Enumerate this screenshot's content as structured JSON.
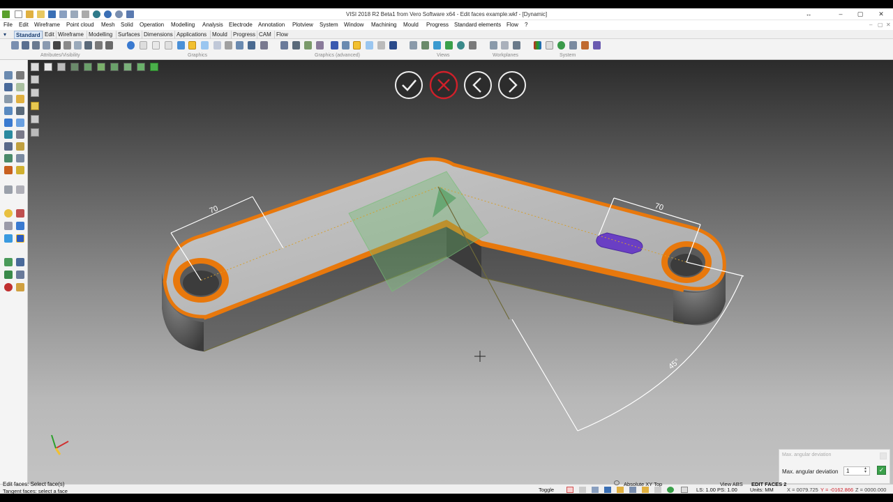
{
  "window": {
    "title": "VISI 2018 R2 Beta1 from Vero Software x64 - Edit faces example.wkf - [Dynamic]"
  },
  "menu": [
    "File",
    "Edit",
    "Wireframe",
    "Point cloud",
    "Mesh",
    "Solid",
    "Operation",
    "Modelling",
    "Analysis",
    "Electrode",
    "Annotation",
    "Plotview",
    "System",
    "Window",
    "Machining",
    "Mould",
    "Progress",
    "Standard elements",
    "Flow",
    "?"
  ],
  "tabs": [
    "Standard",
    "Edit",
    "Wireframe",
    "Modelling",
    "Surfaces",
    "Dimensions",
    "Applications",
    "Mould",
    "Progress",
    "CAM",
    "Flow"
  ],
  "toolbar_groups": [
    "Attributes/Visibility",
    "Graphics",
    "Graphics (advanced)",
    "Views",
    "Workplanes",
    "System"
  ],
  "dims": {
    "left": "70",
    "right": "70",
    "angle": "45°"
  },
  "panel": {
    "title": "Max. angular deviation",
    "label": "Max. angular deviation",
    "value": "1"
  },
  "status": {
    "line1": "Edit faces: Select face(s)",
    "line2": "Tangent faces: select a face",
    "toggle": "Toggle",
    "view": "Absolute XY Top",
    "viewabs": "View ABS",
    "mode": "EDIT FACES 2",
    "scale": "LS: 1.00 PS: 1.00",
    "units": "Units: MM",
    "coord_x": "X = 0079.725",
    "coord_y": "Y = -0162.866",
    "coord_z": "Z = 0000.000"
  },
  "colors": {
    "accent": "#2b6cc4",
    "edge_orange": "#e8780c",
    "slot_purple": "#6a3fc4",
    "cancel_red": "#d0202a"
  },
  "icons": {
    "confirm": "check-icon",
    "cancel": "close-icon",
    "prev": "chevron-left-icon",
    "next": "chevron-right-icon"
  }
}
